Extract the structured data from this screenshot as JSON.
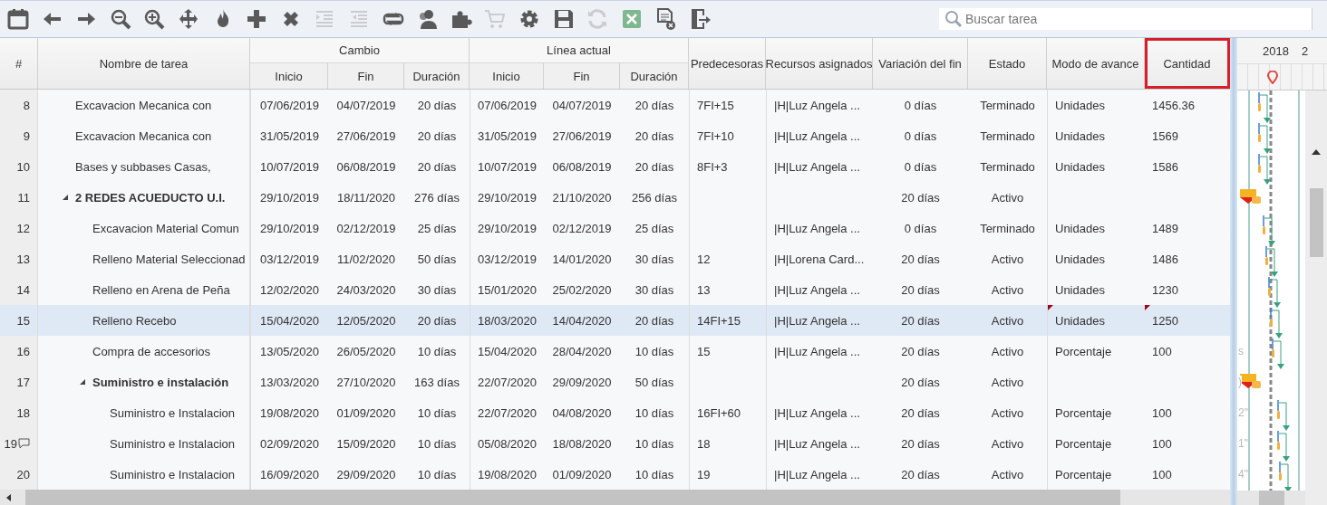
{
  "toolbar": {
    "buttons": [
      {
        "disabled": false
      },
      {
        "disabled": false
      },
      {
        "disabled": false
      },
      {
        "disabled": false
      },
      {
        "disabled": false
      },
      {
        "disabled": false
      },
      {
        "disabled": false
      },
      {
        "disabled": false
      },
      {
        "disabled": false
      },
      {
        "disabled": true
      },
      {
        "disabled": true
      },
      {
        "disabled": false
      },
      {
        "disabled": false
      },
      {
        "disabled": false
      },
      {
        "disabled": true
      },
      {
        "disabled": false
      },
      {
        "disabled": false
      },
      {
        "disabled": true
      },
      {
        "disabled": false
      },
      {
        "disabled": false
      },
      {
        "disabled": false
      }
    ],
    "search": {
      "placeholder": "Buscar tarea"
    }
  },
  "table": {
    "column_groups": [
      {
        "label": "Cambio"
      },
      {
        "label": "Línea actual"
      }
    ],
    "columns": [
      {
        "label": "#",
        "highlighted": false
      },
      {
        "label": "Nombre de tarea",
        "highlighted": false
      },
      {
        "label": "Inicio",
        "highlighted": false
      },
      {
        "label": "Fin",
        "highlighted": false
      },
      {
        "label": "Duración",
        "highlighted": false
      },
      {
        "label": "Inicio",
        "highlighted": false
      },
      {
        "label": "Fin",
        "highlighted": false
      },
      {
        "label": "Duración",
        "highlighted": false
      },
      {
        "label": "Predecesoras",
        "highlighted": false
      },
      {
        "label": "Recursos asignados",
        "highlighted": false
      },
      {
        "label": "Variación del fin",
        "highlighted": false
      },
      {
        "label": "Estado",
        "highlighted": false
      },
      {
        "label": "Modo de avance",
        "highlighted": false
      },
      {
        "label": "Cantidad",
        "highlighted": true
      }
    ],
    "rows": [
      {
        "kind": "task",
        "cells": [
          "8",
          "Excavacion Mecanica con",
          "07/06/2019",
          "04/07/2019",
          "20 días",
          "07/06/2019",
          "04/07/2019",
          "20 días",
          "7FI+15",
          "|H|Luz Angela ...",
          "0 días",
          "Terminado",
          "Unidades",
          "1456.36"
        ],
        "selected": false,
        "comment": false,
        "modified": false
      },
      {
        "kind": "task",
        "cells": [
          "9",
          "Excavacion Mecanica con",
          "31/05/2019",
          "27/06/2019",
          "20 días",
          "31/05/2019",
          "27/06/2019",
          "20 días",
          "7FI+10",
          "|H|Luz Angela ...",
          "0 días",
          "Terminado",
          "Unidades",
          "1569"
        ],
        "selected": false,
        "comment": false,
        "modified": false
      },
      {
        "kind": "task",
        "cells": [
          "10",
          "Bases y subbases Casas,",
          "10/07/2019",
          "06/08/2019",
          "20 días",
          "10/07/2019",
          "06/08/2019",
          "20 días",
          "8FI+3",
          "|H|Luz Angela ...",
          "0 días",
          "Terminado",
          "Unidades",
          "1586"
        ],
        "selected": false,
        "comment": false,
        "modified": false
      },
      {
        "kind": "summary",
        "expanded": true,
        "cells": [
          "11",
          "2 REDES ACUEDUCTO U.I.",
          "29/10/2019",
          "18/11/2020",
          "276 días",
          "29/10/2019",
          "21/10/2020",
          "256 días",
          "",
          "",
          "20 días",
          "Activo",
          "",
          ""
        ],
        "selected": false,
        "comment": false,
        "modified": false,
        "children": [
          {
            "kind": "task",
            "cells": [
              "12",
              "Excavacion Material Comun",
              "29/10/2019",
              "02/12/2019",
              "25 días",
              "29/10/2019",
              "02/12/2019",
              "25 días",
              "",
              "|H|Luz Angela ...",
              "0 días",
              "Terminado",
              "Unidades",
              "1489"
            ],
            "selected": false,
            "comment": false,
            "modified": false
          },
          {
            "kind": "task",
            "cells": [
              "13",
              "Relleno Material Seleccionad",
              "03/12/2019",
              "11/02/2020",
              "50 días",
              "03/12/2019",
              "14/01/2020",
              "30 días",
              "12",
              "|H|Lorena Card...",
              "20 días",
              "Activo",
              "Unidades",
              "1486"
            ],
            "selected": false,
            "comment": false,
            "modified": false
          },
          {
            "kind": "task",
            "cells": [
              "14",
              "Relleno en Arena de Peña",
              "12/02/2020",
              "24/03/2020",
              "30 días",
              "15/01/2020",
              "25/02/2020",
              "30 días",
              "13",
              "|H|Luz Angela ...",
              "20 días",
              "Activo",
              "Unidades",
              "1230"
            ],
            "selected": false,
            "comment": false,
            "modified": false
          },
          {
            "kind": "task",
            "cells": [
              "15",
              "Relleno Recebo",
              "15/04/2020",
              "12/05/2020",
              "20 días",
              "18/03/2020",
              "14/04/2020",
              "20 días",
              "14FI+15",
              "|H|Luz Angela ...",
              "20 días",
              "Activo",
              "Unidades",
              "1250"
            ],
            "selected": true,
            "comment": false,
            "modified": true
          },
          {
            "kind": "task",
            "cells": [
              "16",
              "Compra de accesorios",
              "13/05/2020",
              "26/05/2020",
              "10 días",
              "15/04/2020",
              "28/04/2020",
              "10 días",
              "15",
              "|H|Luz Angela ...",
              "20 días",
              "Activo",
              "Porcentaje",
              "100"
            ],
            "selected": false,
            "comment": false,
            "modified": false,
            "gantt_label": "s"
          },
          {
            "kind": "summary",
            "expanded": true,
            "cells": [
              "17",
              "Suministro e instalación",
              "13/03/2020",
              "27/10/2020",
              "163 días",
              "22/07/2020",
              "29/09/2020",
              "50 días",
              "",
              "",
              "20 días",
              "Activo",
              "",
              ""
            ],
            "selected": false,
            "comment": false,
            "modified": false,
            "gantt_label": ")",
            "children": [
              {
                "kind": "task",
                "cells": [
                  "18",
                  "Suministro e Instalacion",
                  "19/08/2020",
                  "01/09/2020",
                  "10 días",
                  "22/07/2020",
                  "04/08/2020",
                  "10 días",
                  "16FI+60",
                  "|H|Luz Angela ...",
                  "20 días",
                  "Activo",
                  "Porcentaje",
                  "100"
                ],
                "selected": false,
                "comment": false,
                "modified": false,
                "gantt_label": "2\""
              },
              {
                "kind": "task",
                "cells": [
                  "19",
                  "Suministro e Instalacion",
                  "02/09/2020",
                  "15/09/2020",
                  "10 días",
                  "05/08/2020",
                  "18/08/2020",
                  "10 días",
                  "18",
                  "|H|Luz Angela ...",
                  "20 días",
                  "Activo",
                  "Porcentaje",
                  "100"
                ],
                "selected": false,
                "comment": true,
                "modified": false,
                "gantt_label": "1\""
              },
              {
                "kind": "task",
                "cells": [
                  "20",
                  "Suministro e Instalacion",
                  "16/09/2020",
                  "29/09/2020",
                  "10 días",
                  "19/08/2020",
                  "01/09/2020",
                  "10 días",
                  "19",
                  "|H|Luz Angela ...",
                  "20 días",
                  "Activo",
                  "Porcentaje",
                  "100"
                ],
                "selected": false,
                "comment": false,
                "modified": false,
                "gantt_label": "4\""
              }
            ]
          }
        ]
      }
    ]
  },
  "gantt": {
    "years": [
      "2018",
      "2"
    ]
  }
}
